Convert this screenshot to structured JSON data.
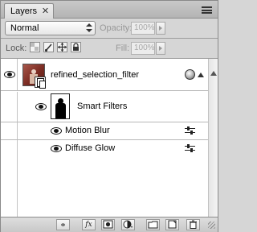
{
  "panel": {
    "tab_label": "Layers",
    "close_glyph": "✕"
  },
  "blend": {
    "mode": "Normal",
    "opacity_label": "Opacity:",
    "opacity_value": "100%"
  },
  "lock": {
    "label": "Lock:",
    "fill_label": "Fill:",
    "fill_value": "100%"
  },
  "layer": {
    "name": "refined_selection_filter",
    "thumbnail": "photo-thumbnail",
    "badge_icon": "smart-object-icon"
  },
  "smart_filters": {
    "label": "Smart Filters"
  },
  "filters": [
    {
      "name": "Motion Blur"
    },
    {
      "name": "Diffuse Glow"
    }
  ],
  "bottom_bar": {
    "link_glyph": "⚭",
    "fx_glyph": "fx"
  }
}
